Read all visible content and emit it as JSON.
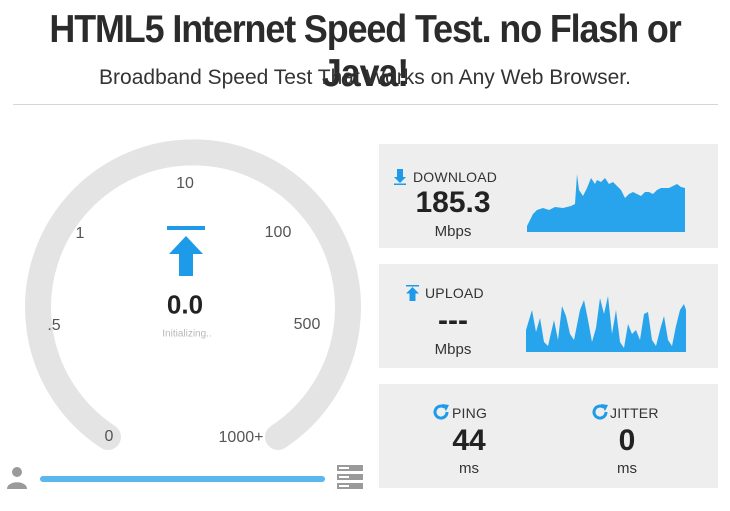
{
  "header": {
    "title": "HTML5 Internet Speed Test. no Flash or Java!",
    "subtitle": "Broadband Speed Test That Works on Any Web Browser."
  },
  "gauge": {
    "scale_labels": [
      "0",
      ".5",
      "1",
      "10",
      "100",
      "500",
      "1000+"
    ],
    "value": "0.0",
    "status": "Initializing..",
    "progress_fraction": 1.0
  },
  "download": {
    "label": "DOWNLOAD",
    "value": "185.3",
    "unit": "Mbps"
  },
  "upload": {
    "label": "UPLOAD",
    "value": "---",
    "unit": "Mbps"
  },
  "ping": {
    "label": "PING",
    "value": "44",
    "unit": "ms"
  },
  "jitter": {
    "label": "JITTER",
    "value": "0",
    "unit": "ms"
  },
  "colors": {
    "accent": "#1e9be8",
    "gauge_track": "#e4e4e4",
    "panel_bg": "#eeeeee"
  },
  "icons": [
    "download-arrow-icon",
    "upload-arrow-icon",
    "refresh-icon",
    "user-icon",
    "server-icon",
    "arrow-up-icon"
  ]
}
